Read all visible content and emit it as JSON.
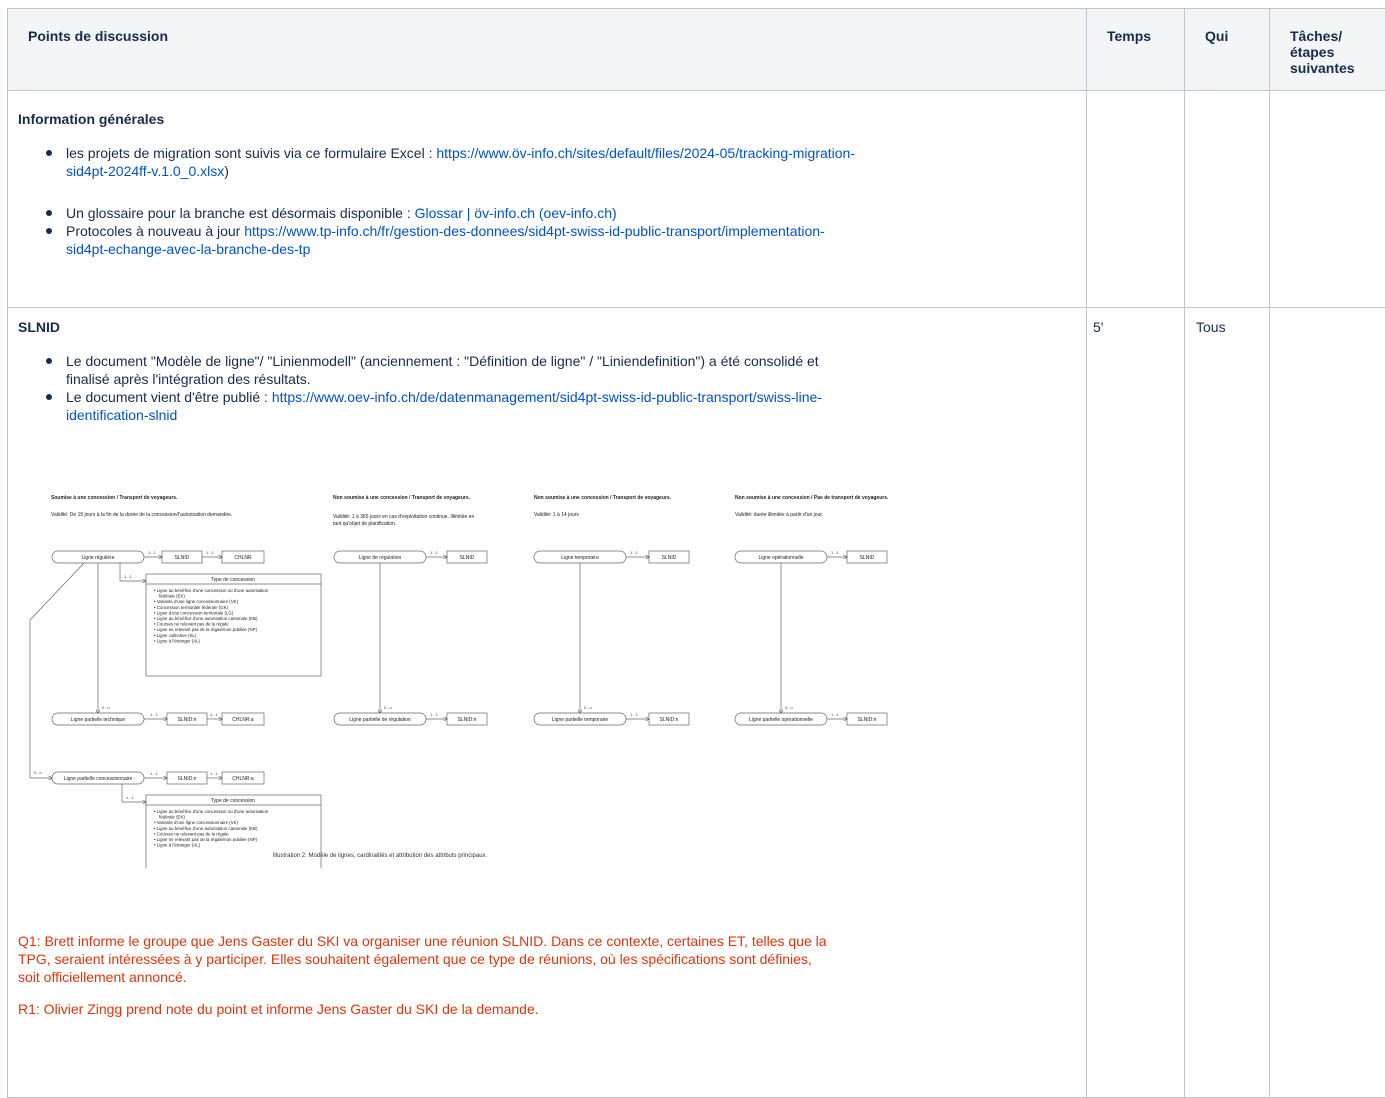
{
  "headers": {
    "points": "Points de discussion",
    "temps": "Temps",
    "qui": "Qui",
    "taches_l1": "Tâches/",
    "taches_l2": "étapes",
    "taches_l3": "suivantes"
  },
  "row1": {
    "title": "Information générales",
    "b1_text": "les projets de migration sont suivis via ce formulaire Excel : ",
    "b1_link_a": "https://www.öv-info.ch/sites/default/files/2024-05/tracking-migration-",
    "b1_link_b": "sid4pt-2024ff-v.1.0_0.xlsx",
    "b1_tail": ")",
    "b2_text": "Un glossaire pour la branche est désormais disponible : ",
    "b2_link": "Glossar | öv-info.ch (oev-info.ch)",
    "b3_text": "Protocoles à nouveau à jour ",
    "b3_link_a": "https://www.tp-info.ch/fr/gestion-des-donnees/sid4pt-swiss-id-public-transport/implementation-",
    "b3_link_b": "sid4pt-echange-avec-la-branche-des-tp"
  },
  "row2": {
    "title": "SLNID",
    "temps": "5'",
    "qui": "Tous",
    "b1_l1": "Le document \"Modèle de ligne\"/ \"Linienmodell\"  (anciennement : \"Définition de ligne\" / \"Liniendefinition\") a été consolidé et",
    "b1_l2": "finalisé après l'intégration des résultats.",
    "b2_text": "Le document vient d'être publié : ",
    "b2_link_a": "https://www.oev-info.ch/de/datenmanagement/sid4pt-swiss-id-public-transport/swiss-line-",
    "b2_link_b": "identification-slnid",
    "q1_l1": "Q1: Brett informe le groupe que Jens Gaster du SKI va organiser une réunion SLNID. Dans ce contexte, certaines ET, telles que la",
    "q1_l2": "TPG, seraient intéressées à y participer. Elles souhaitent également que ce type de réunions, où les spécifications sont définies,",
    "q1_l3": "soit officiellement annoncé.",
    "r1": "R1: Olivier Zingg prend note du point et informe Jens Gaster du SKI de la demande."
  },
  "diagram": {
    "caption": "Illustration 2: Modèle de lignes, cardinalités et attribution des attributs principaux.",
    "col1_title": "Soumise à une concession / Transport de voyageurs.",
    "col1_valid": "Validité:  De 15 jours à la fin de la durée de la concession/l'autorisation demandée.",
    "col2_title": "Non soumise à une concession / Transport de voyageurs.",
    "col2_valid_l1": "Validité: 1 à 365 jours en cas d'exploitation continue. Illimitée en",
    "col2_valid_l2": "tant qu'objet de planification.",
    "col3_title": "Non soumise à une concession / Transport de voyageurs.",
    "col3_valid": "Validité: 1 à 14 jours",
    "col4_title": "Non soumise à une concession / Pas de transport de voyageurs.",
    "col4_valid": "Validité: durée illimitée à partir d'un jour.",
    "ligne_reguliere": "Ligne régulière",
    "ligne_regulation": "Ligne de régulation",
    "ligne_temporaire": "Ligne temporaire",
    "ligne_operationnelle": "Ligne opérationnelle",
    "lp_technique": "Ligne partielle technique",
    "lp_regulation": "Ligne partielle de régulation",
    "lp_temporaire": "Ligne partielle temporaire",
    "lp_operationnelle": "Ligne partielle opérationnelle",
    "lp_concessionnaire": "Ligne partielle concessionnaire",
    "slnid": "SLNID",
    "slnid_n": "SLNID:n",
    "chlnr": "CHLNR",
    "chlnr_a": "CHLNR:a",
    "card_11": "1...1",
    "card_0n": "0...n",
    "type_concession": "Type de concession",
    "tc1": [
      "Ligne au bénéfice d'une concession ou d'une autorisation",
      "fédérale (EK)",
      "Variante d'une ligne concessionnaire (VK)",
      "Concession territoriale fédérale (GK)",
      "Ligne d'une concession territoriale (LG)",
      "Ligne au bénéfice d'une autorisation cantonale (KB)",
      "Courses ne relevant pas de la régale",
      "Ligne ne relevant pas de la régale/non publiée (NP)",
      "Ligne collective (SL)",
      "Ligne à l'étranger (AL)"
    ],
    "tc2": [
      "Ligne au bénéfice d'une concession ou d'une autorisation",
      "fédérale (EK)",
      "Variante d'une ligne concessionnaire (VK)",
      "Ligne au bénéfice d'une autorisation cantonale (KB)",
      "Courses ne relevant pas de la régale",
      "Ligne ne relevant pas de la régale/non publiée (NP)",
      "Ligne à l'étranger (AL)"
    ]
  }
}
